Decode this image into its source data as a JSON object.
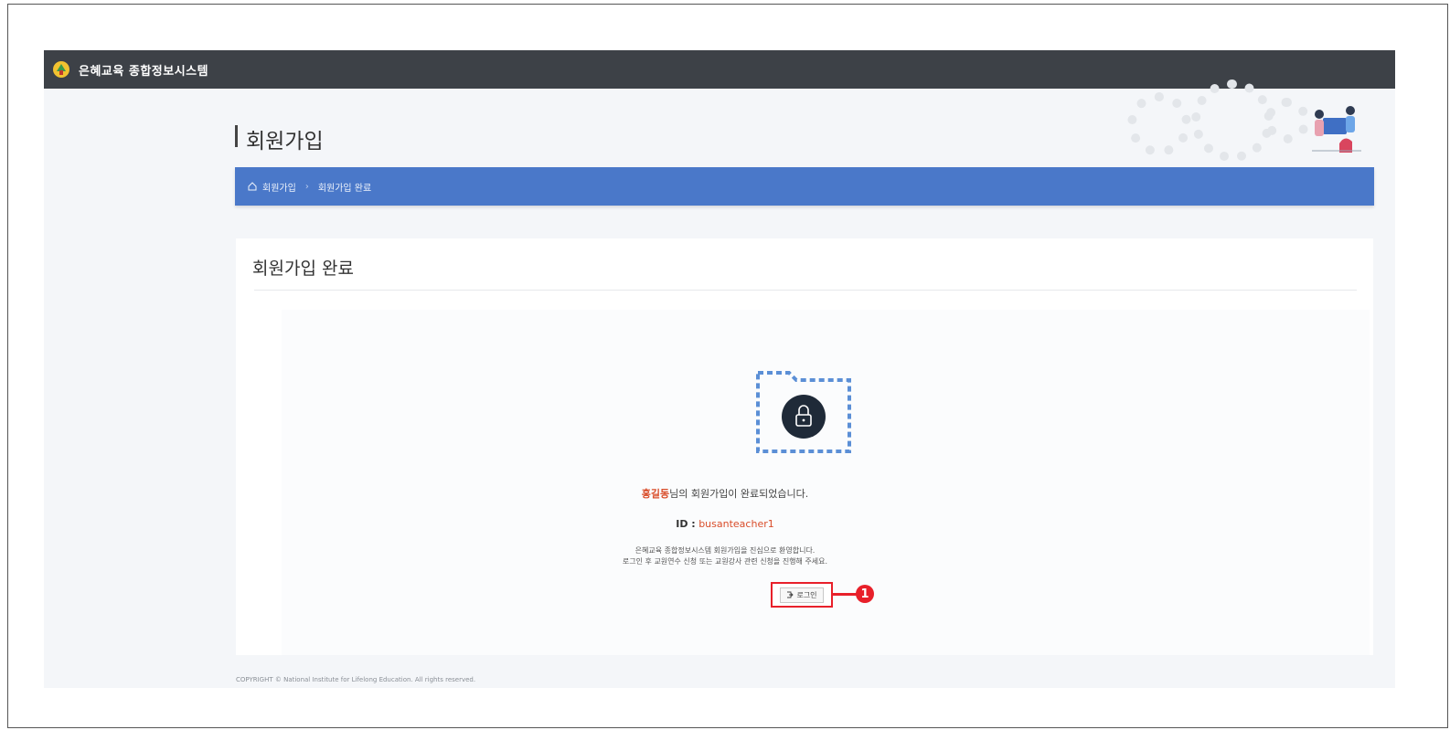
{
  "app": {
    "title": "은혜교육 종합정보시스템",
    "logo_icon": "emblem-icon"
  },
  "page": {
    "title": "회원가입"
  },
  "breadcrumb": {
    "home_icon": "home-icon",
    "items": [
      "회원가입",
      "회원가입 완료"
    ]
  },
  "card": {
    "title": "회원가입 완료",
    "icon": "lock-folder-icon",
    "message_name": "홍길동",
    "message_suffix": "님의 회원가입이 완료되었습니다.",
    "id_label": "ID :",
    "id_value": "busanteacher1",
    "note_line1": "은혜교육 종합정보시스템 회원가입을 진심으로 환영합니다.",
    "note_line2": "로그인 후 교원연수 신청 또는 교원강사 관련 신청을 진행해 주세요.",
    "login_button_label": "로그인",
    "login_icon": "login-icon"
  },
  "callout": {
    "number": "1"
  },
  "footer": {
    "copyright": "COPYRIGHT © National Institute for Lifelong Education. All rights reserved."
  },
  "colors": {
    "topbar": "#3d4147",
    "breadcrumb": "#4a78c9",
    "accent_red": "#e8202a",
    "name_red": "#d94d2a",
    "content_bg": "#f4f6f9"
  }
}
